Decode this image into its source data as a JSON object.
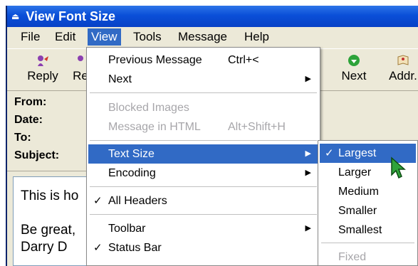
{
  "window": {
    "title": "View Font Size"
  },
  "menubar": {
    "items": [
      "File",
      "Edit",
      "View",
      "Tools",
      "Message",
      "Help"
    ],
    "active": "View"
  },
  "toolbar": {
    "buttons": [
      {
        "label": "Reply",
        "icon": "reply-icon"
      },
      {
        "label": "Re",
        "icon": "reply-all-icon"
      },
      {
        "label": "Next",
        "icon": "next-arrow-icon"
      },
      {
        "label": "Addr.",
        "icon": "address-book-icon"
      }
    ]
  },
  "headers": {
    "from": "From:",
    "date": "Date:",
    "to": "To:",
    "subject": "Subject:"
  },
  "message": {
    "line1": "This is ho",
    "line2": "Be great,",
    "line3": "Darry D"
  },
  "view_menu": {
    "previous": {
      "label": "Previous Message",
      "shortcut": "Ctrl+<"
    },
    "next": "Next",
    "blocked_images": "Blocked Images",
    "message_html": {
      "label": "Message in HTML",
      "shortcut": "Alt+Shift+H"
    },
    "text_size": "Text Size",
    "encoding": "Encoding",
    "all_headers": "All Headers",
    "toolbar": "Toolbar",
    "status_bar": "Status Bar"
  },
  "text_size_menu": {
    "largest": "Largest",
    "larger": "Larger",
    "medium": "Medium",
    "smaller": "Smaller",
    "smallest": "Smallest",
    "fixed": "Fixed"
  },
  "glyphs": {
    "check": "✓",
    "submenu_arrow": "▶",
    "title_icon": "⏏"
  },
  "colors": {
    "title_bar": "#0a4fd8",
    "highlight": "#316ac5",
    "cursor": "#2fa33a"
  }
}
